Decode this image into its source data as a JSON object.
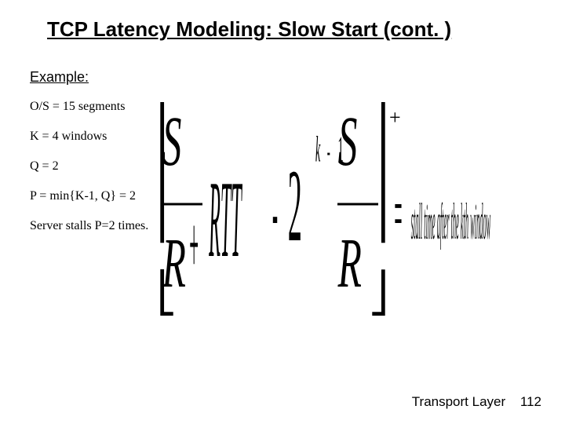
{
  "title": "TCP Latency Modeling: Slow Start (cont. )",
  "example_label": "Example:",
  "lines": {
    "l1": "O/S  = 15 segments",
    "l2": "K = 4 windows",
    "l3": "Q = 2",
    "l4": "P = min{K-1, Q} = 2",
    "l5": "Server stalls P=2 times."
  },
  "equation": {
    "lbracket1": "⎡",
    "lbracket2": "⎢",
    "lbracket3": "⎣",
    "S_big1": "S",
    "R_big1": "R",
    "plus": "+",
    "RTT": "RTT",
    "minus1": "-",
    "two": "2",
    "exp_k": "k",
    "exp_minus": "-",
    "exp_1": "1",
    "S_big2": "S",
    "R_big2": "R",
    "rbracket1": "⎤",
    "rbracket2": "⎥",
    "rbracket3": "⎦",
    "eq_sign": "=",
    "rhs": "stall time after the kth window",
    "plus_sup": "+"
  },
  "footer_text": "Transport Layer",
  "footer_page": "112"
}
